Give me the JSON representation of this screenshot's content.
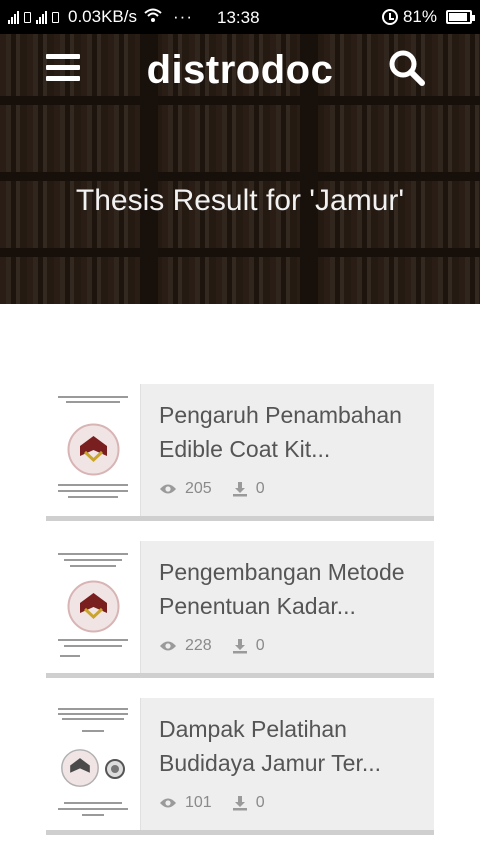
{
  "status_bar": {
    "network_speed": "0.03KB/s",
    "overflow": "···",
    "time": "13:38",
    "battery_percent": "81%",
    "battery_level": 0.81
  },
  "header": {
    "brand": "distrodoc",
    "menu_icon": "hamburger-menu-icon",
    "search_icon": "search-icon"
  },
  "hero": {
    "title": "Thesis Result for 'Jamur'"
  },
  "results": [
    {
      "title_line1": "Pengaruh Penambahan",
      "title_line2": "Edible Coat Kit...",
      "views": "205",
      "downloads": "0"
    },
    {
      "title_line1": "Pengembangan Metode",
      "title_line2": "Penentuan Kadar...",
      "views": "228",
      "downloads": "0"
    },
    {
      "title_line1": "Dampak Pelatihan",
      "title_line2": "Budidaya Jamur Ter...",
      "views": "101",
      "downloads": "0"
    }
  ],
  "colors": {
    "card_bg": "#eeeeee",
    "card_border": "#cfcfcf",
    "title_text": "#555555",
    "stat_text": "#8a8a8a"
  }
}
